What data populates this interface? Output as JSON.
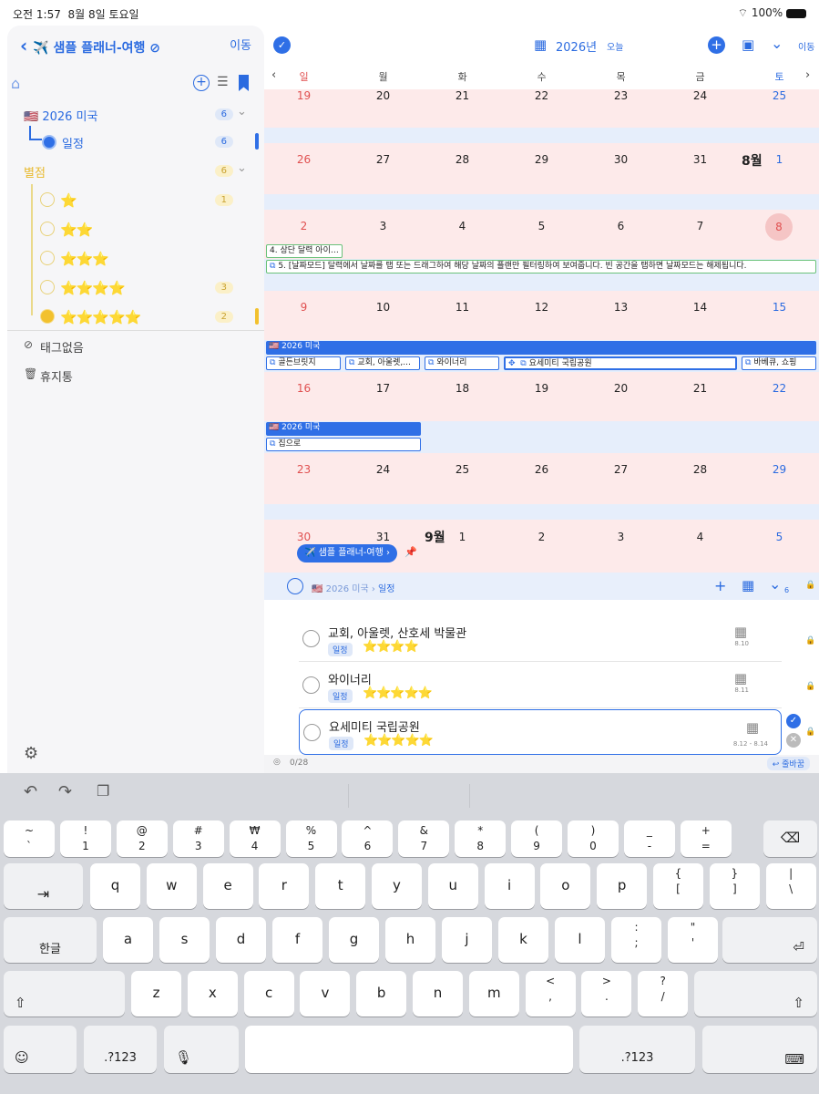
{
  "status": {
    "time": "오전 1:57",
    "date": "8월 8일 토요일",
    "battery": "100%"
  },
  "sidebar": {
    "back": "‹",
    "title": "✈️ 샘플 플래너-여행",
    "move": "이동",
    "group1": {
      "label": "🇺🇸 2026 미국",
      "count": "6"
    },
    "schedule": {
      "label": "일정",
      "count": "6"
    },
    "group2": {
      "label": "별점",
      "count": "6"
    },
    "ratings": [
      {
        "stars": "⭐",
        "count": "1"
      },
      {
        "stars": "⭐⭐",
        "count": ""
      },
      {
        "stars": "⭐⭐⭐",
        "count": ""
      },
      {
        "stars": "⭐⭐⭐⭐",
        "count": "3"
      },
      {
        "stars": "⭐⭐⭐⭐⭐",
        "count": "2"
      }
    ],
    "untagged": "태그없음",
    "trash": "휴지통"
  },
  "calendar": {
    "year": "2026년",
    "today": "오늘",
    "move": "이동",
    "weekdays": [
      "일",
      "월",
      "화",
      "수",
      "목",
      "금",
      "토"
    ],
    "weeks": [
      [
        "19",
        "20",
        "21",
        "22",
        "23",
        "24",
        "25"
      ],
      [
        "26",
        "27",
        "28",
        "29",
        "30",
        "31",
        "1"
      ],
      [
        "2",
        "3",
        "4",
        "5",
        "6",
        "7",
        "8"
      ],
      [
        "9",
        "10",
        "11",
        "12",
        "13",
        "14",
        "15"
      ],
      [
        "16",
        "17",
        "18",
        "19",
        "20",
        "21",
        "22"
      ],
      [
        "23",
        "24",
        "25",
        "26",
        "27",
        "28",
        "29"
      ],
      [
        "30",
        "31",
        "1",
        "2",
        "3",
        "4",
        "5"
      ]
    ],
    "month_aug": "8월",
    "month_sep": "9월",
    "events": {
      "tip4": "4. 상단 달력 아이…",
      "tip5": "5. [날짜모드] 달력에서 날짜를 탭 또는 드래그하여 해당 날짜의 플랜만 필터링하여 보여줍니다. 빈 공간을 탭하면 날짜모드는 해제됩니다.",
      "trip1": "🇺🇸 2026 미국",
      "golden": "골든브릿지",
      "church": "교회, 아울렛,...",
      "winery": "와이너리",
      "yosemite": "요세미티 국립공원",
      "bbq": "바베큐, 쇼핑",
      "trip2": "🇺🇸 2026 미국",
      "home": "집으로"
    },
    "planner_pill": "✈️ 샘플 플래너-여행 ›"
  },
  "list": {
    "breadcrumb_group": "🇺🇸 2026 미국",
    "breadcrumb_item": "일정",
    "count": "6",
    "items": [
      {
        "title": "교회, 아울렛, 산호세 박물관",
        "tag": "일정",
        "stars": "⭐⭐⭐⭐",
        "date": "8.10"
      },
      {
        "title": "와이너리",
        "tag": "일정",
        "stars": "⭐⭐⭐⭐⭐",
        "date": "8.11"
      },
      {
        "title": "요세미티 국립공원",
        "tag": "일정",
        "stars": "⭐⭐⭐⭐⭐",
        "date": "8.12 - 8.14"
      }
    ],
    "progress": "0/28",
    "linebreak": "↩ 줄바꿈"
  },
  "keyboard": {
    "row1": [
      [
        "~",
        "`"
      ],
      [
        "!",
        "1"
      ],
      [
        "@",
        "2"
      ],
      [
        "#",
        "3"
      ],
      [
        "₩",
        "4"
      ],
      [
        "%",
        "5"
      ],
      [
        "^",
        "6"
      ],
      [
        "&",
        "7"
      ],
      [
        "*",
        "8"
      ],
      [
        "(",
        "9"
      ],
      [
        ")",
        "0"
      ],
      [
        "_",
        "-"
      ],
      [
        "+",
        "="
      ]
    ],
    "row2": [
      [
        "",
        "q"
      ],
      [
        "",
        "w"
      ],
      [
        "",
        "e"
      ],
      [
        "",
        "r"
      ],
      [
        "",
        "t"
      ],
      [
        "",
        "y"
      ],
      [
        "",
        "u"
      ],
      [
        "",
        "i"
      ],
      [
        "",
        "o"
      ],
      [
        "",
        "p"
      ],
      [
        "{",
        "["
      ],
      [
        "}",
        "]"
      ],
      [
        "|",
        "\\"
      ]
    ],
    "row3": [
      [
        "",
        "a"
      ],
      [
        "",
        "s"
      ],
      [
        "",
        "d"
      ],
      [
        "",
        "f"
      ],
      [
        "",
        "g"
      ],
      [
        "",
        "h"
      ],
      [
        "",
        "j"
      ],
      [
        "",
        "k"
      ],
      [
        "",
        "l"
      ],
      [
        ":",
        ";"
      ],
      [
        "\"",
        "'"
      ]
    ],
    "row4": [
      [
        "",
        "z"
      ],
      [
        "",
        "x"
      ],
      [
        "",
        "c"
      ],
      [
        "",
        "v"
      ],
      [
        "",
        "b"
      ],
      [
        "",
        "n"
      ],
      [
        "",
        "m"
      ],
      [
        "<",
        ","
      ],
      [
        ">",
        "."
      ],
      [
        "?",
        "/"
      ]
    ],
    "hangul": "한글",
    "num1": ".?123",
    "num2": ".?123"
  },
  "colors": {
    "accent": "#2f6fe6",
    "weekend_sun": "#e05050",
    "week_bg": "#fdeaea",
    "star": "#f2c12e"
  }
}
